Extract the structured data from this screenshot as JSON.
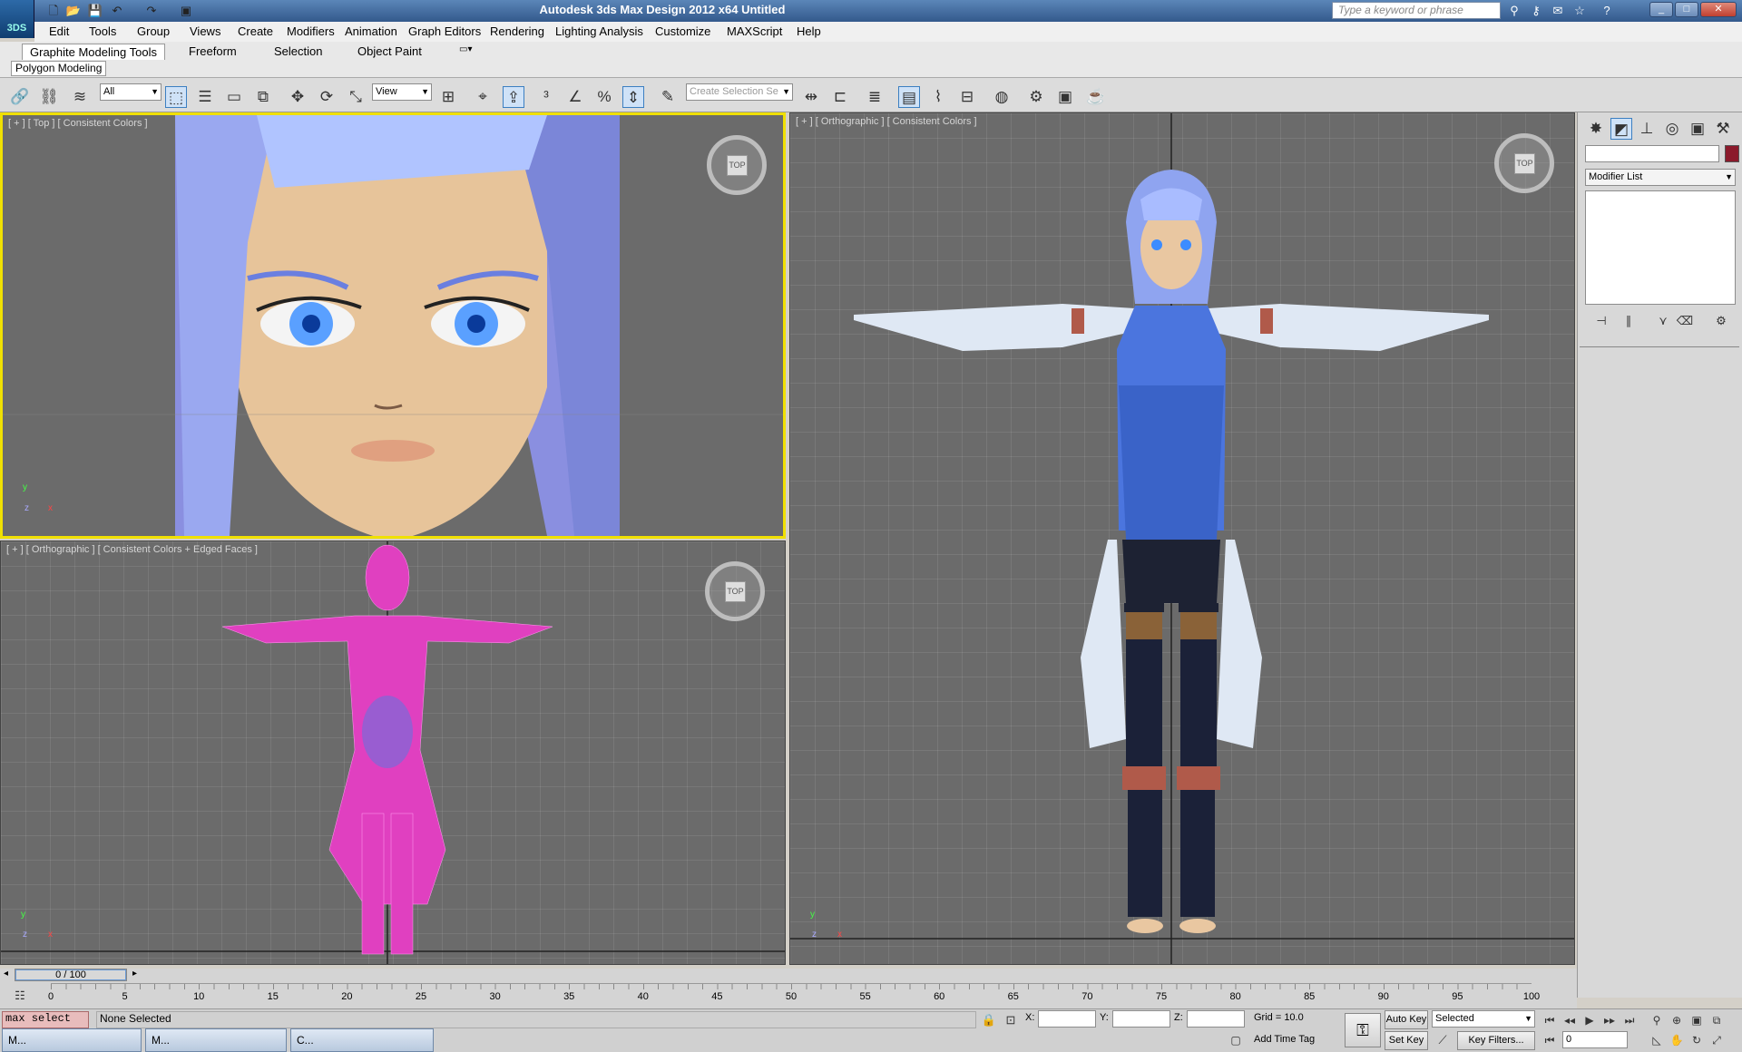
{
  "window": {
    "title": "Autodesk 3ds Max Design 2012 x64    Untitled",
    "app_badge": "3DS",
    "search_placeholder": "Type a keyword or phrase",
    "minimize": "_",
    "restore": "□",
    "close": "✕"
  },
  "menu": [
    "Edit",
    "Tools",
    "Group",
    "Views",
    "Create",
    "Modifiers",
    "Animation",
    "Graph Editors",
    "Rendering",
    "Lighting Analysis",
    "Customize",
    "MAXScript",
    "Help"
  ],
  "ribbon": {
    "tabs": [
      "Graphite Modeling Tools",
      "Freeform",
      "Selection",
      "Object Paint"
    ],
    "sub_tab": "Polygon Modeling"
  },
  "toolbar": {
    "filter": "All",
    "refcoord": "View",
    "named_selection_placeholder": "Create Selection Se"
  },
  "viewports": {
    "top_left": {
      "label": "[ + ] [ Top ] [ Consistent Colors ]",
      "cube": "TOP"
    },
    "bottom_left": {
      "label": "[ + ] [ Orthographic ] [ Consistent Colors + Edged Faces ]",
      "cube": "TOP"
    },
    "right": {
      "label": "[ + ] [ Orthographic ] [ Consistent Colors ]",
      "cube": "TOP"
    }
  },
  "command_panel": {
    "object_color": "#8b1a2b",
    "modifier_list": "Modifier List"
  },
  "timeline": {
    "slider": "0 / 100",
    "ticks": [
      "0",
      "5",
      "10",
      "15",
      "20",
      "25",
      "30",
      "35",
      "40",
      "45",
      "50",
      "55",
      "60",
      "65",
      "70",
      "75",
      "80",
      "85",
      "90",
      "95",
      "100"
    ]
  },
  "status": {
    "script_listener": "max select",
    "selection": "None Selected",
    "x_label": "X:",
    "y_label": "Y:",
    "z_label": "Z:",
    "grid": "Grid = 10.0",
    "add_time_tag": "Add Time Tag",
    "auto_key": "Auto Key",
    "set_key": "Set Key",
    "key_mode": "Selected",
    "key_filters": "Key Filters...",
    "frame": "0"
  },
  "taskbar": [
    "M...",
    "M...",
    "C..."
  ],
  "colors": {
    "active_viewport": "#f0e000",
    "wire": "#e040c0",
    "hair": "#9aa8f0"
  }
}
